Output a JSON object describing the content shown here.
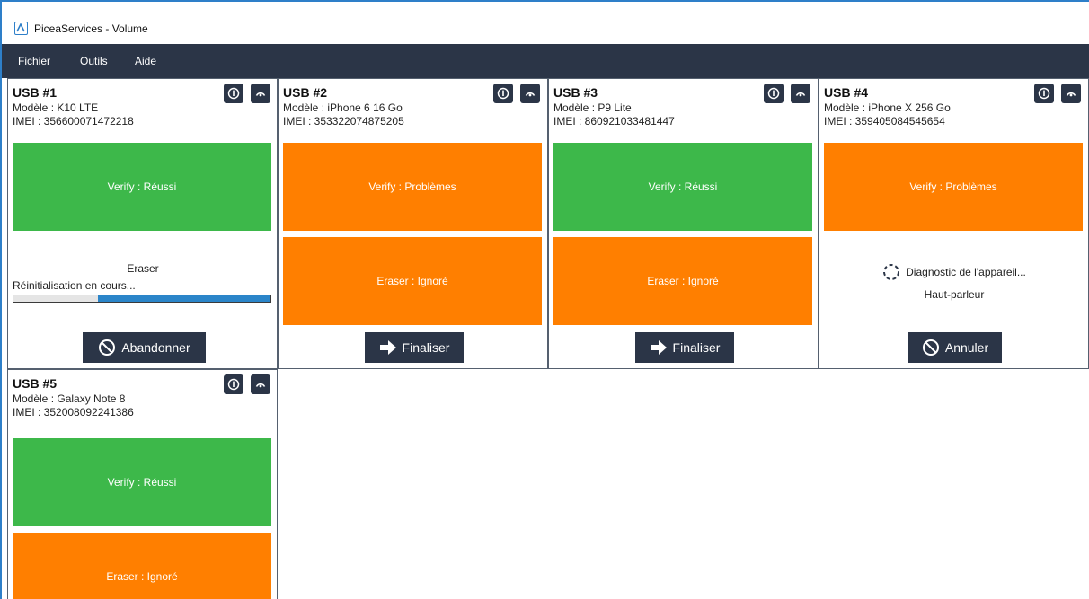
{
  "window": {
    "title": "PiceaServices - Volume",
    "accent": "#2e7fc9"
  },
  "menubar": {
    "items": [
      "Fichier",
      "Outils",
      "Aide"
    ],
    "background": "#2b3547"
  },
  "colors": {
    "success": "#3db84a",
    "warning": "#ff7f00",
    "dark": "#2b3547",
    "progress": "#2b85c9"
  },
  "icons": {
    "info": "info-icon",
    "gauge": "gauge-icon",
    "cancel": "cancel-icon",
    "arrow": "arrow-right-icon",
    "spinner": "spinner-icon"
  },
  "panels": [
    {
      "title": "USB #1",
      "model": "Modèle : K10 LTE",
      "imei": "IMEI : 356600071472218",
      "verify": "Verify : Réussi",
      "eraser_title": "Eraser",
      "progress_text": "Réinitialisation en cours...",
      "progress_value": 0.67,
      "button": "Abandonner"
    },
    {
      "title": "USB #2",
      "model": "Modèle : iPhone 6 16 Go",
      "imei": "IMEI : 353322074875205",
      "verify": "Verify : Problèmes",
      "eraser": "Eraser : Ignoré",
      "button": "Finaliser"
    },
    {
      "title": "USB #3",
      "model": "Modèle : P9 Lite",
      "imei": "IMEI : 860921033481447",
      "verify": "Verify : Réussi",
      "eraser": "Eraser : Ignoré",
      "button": "Finaliser"
    },
    {
      "title": "USB #4",
      "model": "Modèle : iPhone X 256 Go",
      "imei": "IMEI : 359405084545654",
      "verify": "Verify : Problèmes",
      "diagnostic": "Diagnostic de l'appareil...",
      "diagnostic_sub": "Haut-parleur",
      "button": "Annuler"
    },
    {
      "title": "USB #5",
      "model": "Modèle : Galaxy Note 8",
      "imei": "IMEI : 352008092241386",
      "verify": "Verify : Réussi",
      "eraser": "Eraser : Ignoré"
    }
  ]
}
